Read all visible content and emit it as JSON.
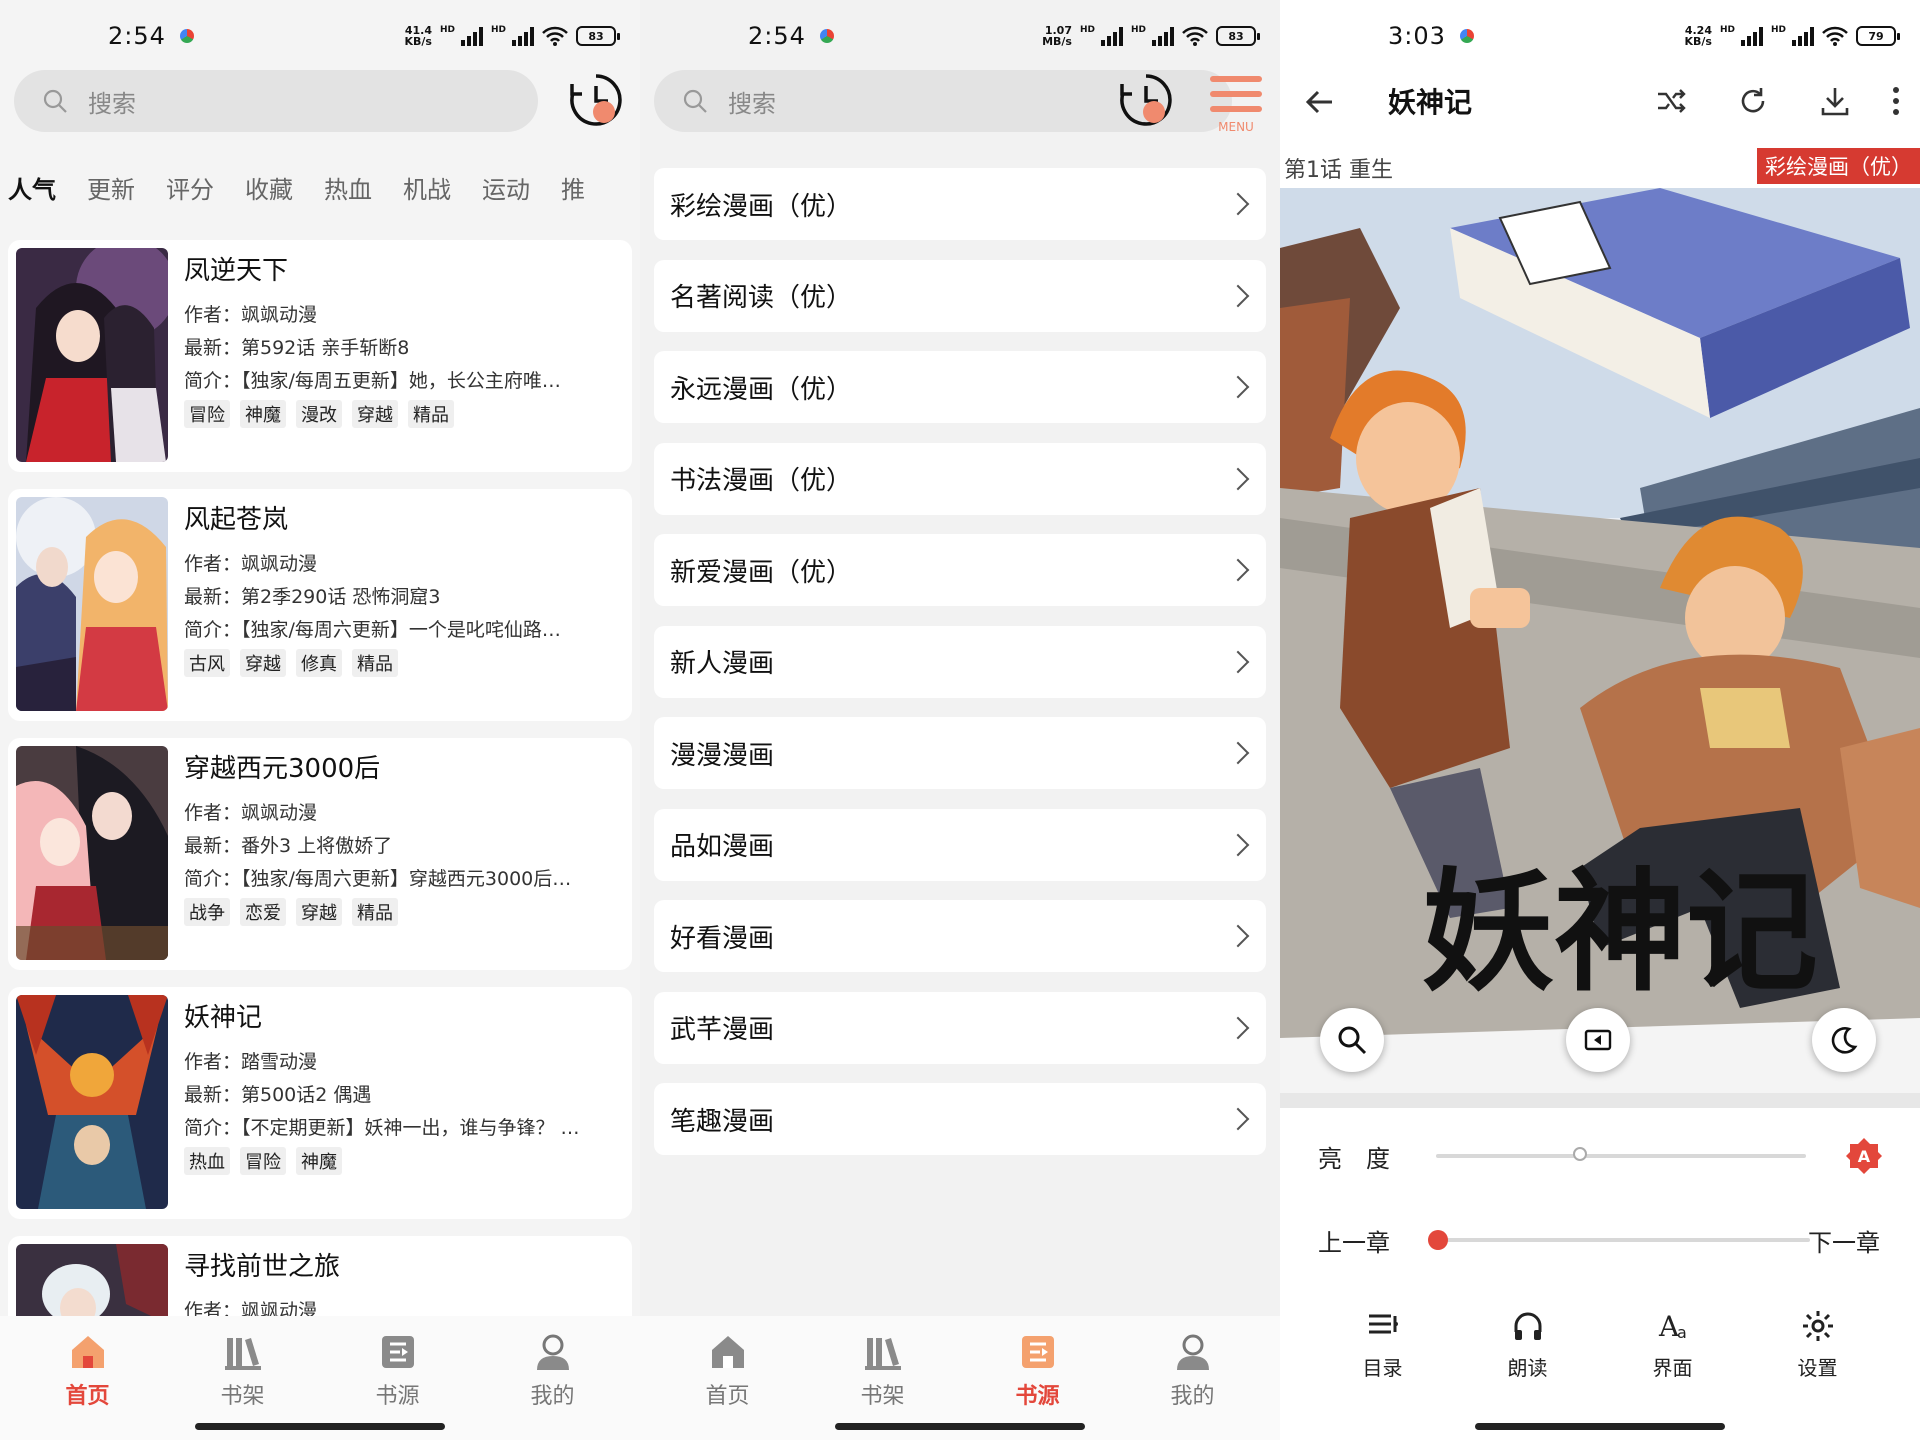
{
  "panel1": {
    "status": {
      "time": "2:54",
      "speed_value": "41.4",
      "speed_unit": "KB/s",
      "battery": "83"
    },
    "search_placeholder": "搜索",
    "tabs": [
      "人气",
      "更新",
      "评分",
      "收藏",
      "热血",
      "机战",
      "运动",
      "推"
    ],
    "books": [
      {
        "title": "凤逆天下",
        "author": "作者：飒飒动漫",
        "latest": "最新：第592话 亲手斩断8",
        "intro": "简介：【独家/每周五更新】她，长公主府唯…",
        "tags": [
          "冒险",
          "神魔",
          "漫改",
          "穿越",
          "精品"
        ]
      },
      {
        "title": "风起苍岚",
        "author": "作者：飒飒动漫",
        "latest": "最新：第2季290话 恐怖洞窟3",
        "intro": "简介：【独家/每周六更新】一个是叱咤仙路…",
        "tags": [
          "古风",
          "穿越",
          "修真",
          "精品"
        ]
      },
      {
        "title": "穿越西元3000后",
        "author": "作者：飒飒动漫",
        "latest": "最新：番外3 上将傲娇了",
        "intro": "简介：【独家/每周六更新】穿越西元3000后…",
        "tags": [
          "战争",
          "恋爱",
          "穿越",
          "精品"
        ]
      },
      {
        "title": "妖神记",
        "author": "作者：踏雪动漫",
        "latest": "最新：第500话2 偶遇",
        "intro": "简介：【不定期更新】妖神一出，谁与争锋？ …",
        "tags": [
          "热血",
          "冒险",
          "神魔"
        ]
      },
      {
        "title": "寻找前世之旅",
        "author": "作者：飒飒动漫",
        "latest": "",
        "intro": "",
        "tags": []
      }
    ],
    "nav": [
      {
        "label": "首页",
        "icon": "home-icon",
        "active": true
      },
      {
        "label": "书架",
        "icon": "bookshelf-icon",
        "active": false
      },
      {
        "label": "书源",
        "icon": "source-icon",
        "active": false
      },
      {
        "label": "我的",
        "icon": "profile-icon",
        "active": false
      }
    ]
  },
  "panel2": {
    "status": {
      "time": "2:54",
      "speed_value": "1.07",
      "speed_unit": "MB/s",
      "battery": "83"
    },
    "search_placeholder": "搜索",
    "menu_label": "MENU",
    "sources": [
      "彩绘漫画（优）",
      "名著阅读（优）",
      "永远漫画（优）",
      "书法漫画（优）",
      "新爱漫画（优）",
      "新人漫画",
      "漫漫漫画",
      "品如漫画",
      "好看漫画",
      "武芊漫画",
      "笔趣漫画"
    ],
    "nav": [
      {
        "label": "首页",
        "icon": "home-icon",
        "active": false
      },
      {
        "label": "书架",
        "icon": "bookshelf-icon",
        "active": false
      },
      {
        "label": "书源",
        "icon": "source-icon",
        "active": true
      },
      {
        "label": "我的",
        "icon": "profile-icon",
        "active": false
      }
    ]
  },
  "panel3": {
    "status": {
      "time": "3:03",
      "speed_value": "4.24",
      "speed_unit": "KB/s",
      "battery": "79"
    },
    "title": "妖神记",
    "chapter": "第1话 重生",
    "source_badge": "彩绘漫画（优）",
    "comic_title_art": "妖神记",
    "brightness_label": "亮　度",
    "brightness_value": 0.39,
    "prev_chapter": "上一章",
    "next_chapter": "下一章",
    "chapter_progress": 0.0,
    "tools": [
      {
        "label": "目录",
        "icon": "catalog-icon"
      },
      {
        "label": "朗读",
        "icon": "headphones-icon"
      },
      {
        "label": "界面",
        "icon": "font-icon"
      },
      {
        "label": "设置",
        "icon": "settings-icon"
      }
    ],
    "colors": {
      "accent": "#e3473b",
      "badge": "#d63a31"
    }
  }
}
